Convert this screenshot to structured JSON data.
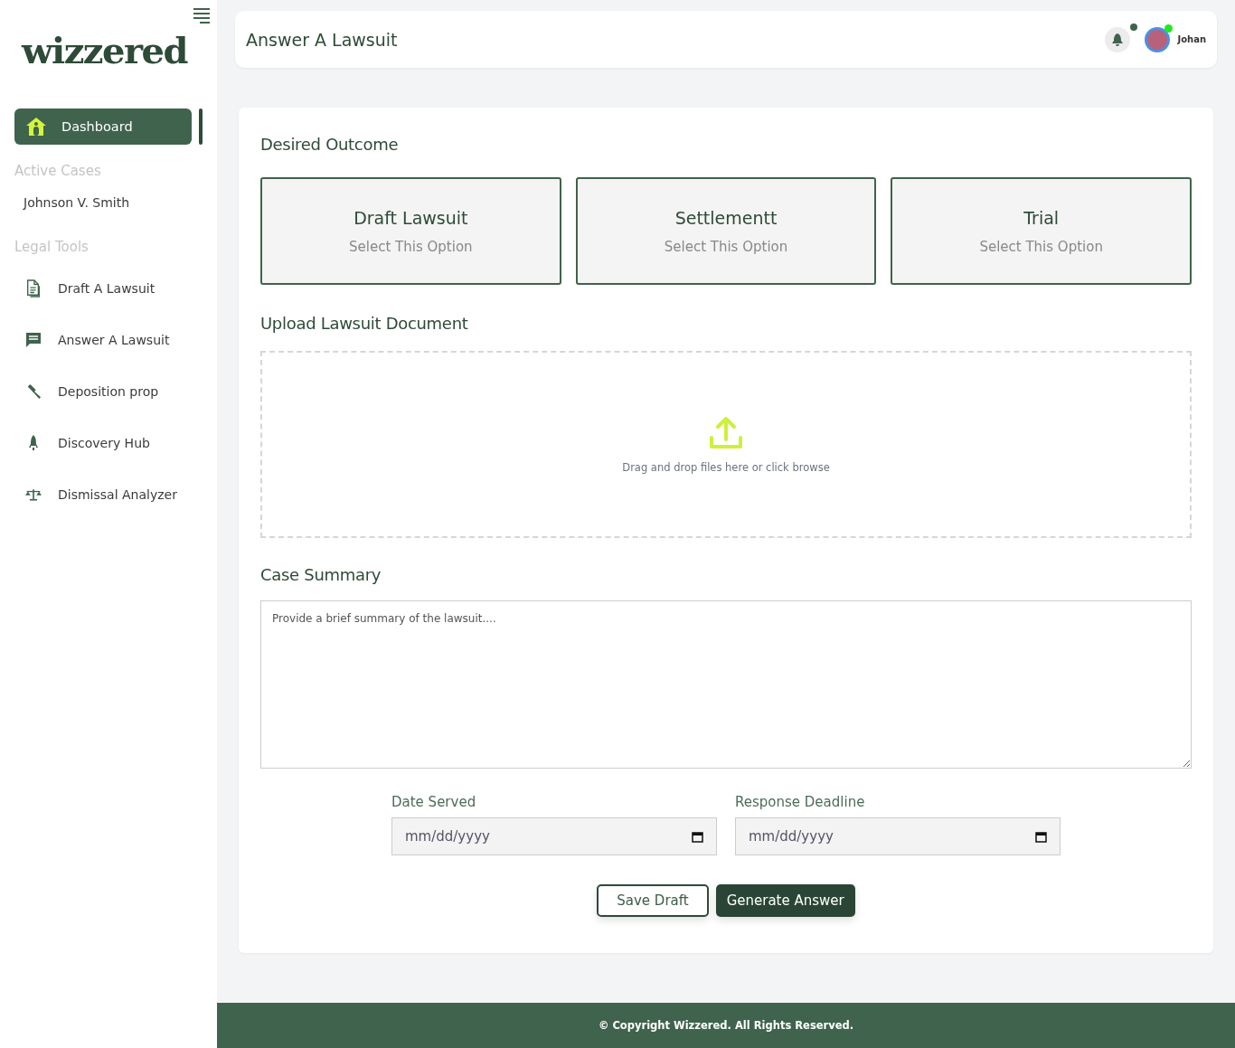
{
  "sidebar": {
    "logo": "wizzered",
    "nav": [
      {
        "label": "Dashboard",
        "selected": true
      }
    ],
    "sections": [
      {
        "title": "Active Cases",
        "items": [
          {
            "label": "Johnson V. Smith",
            "selected": false
          }
        ]
      },
      {
        "title": "Legal Tools",
        "items": [
          {
            "label": "Draft A Lawsuit",
            "selected": false
          },
          {
            "label": "Answer A Lawsuit",
            "selected": false
          },
          {
            "label": "Deposition prop",
            "selected": false
          },
          {
            "label": "Discovery Hub",
            "selected": false
          },
          {
            "label": "Dismissal Analyzer",
            "selected": false
          }
        ]
      }
    ]
  },
  "header": {
    "title": "Answer A Lawsuit",
    "user": "Johan",
    "notification_unread": true,
    "user_online": true
  },
  "outcome": {
    "title": "Desired Outcome",
    "options": [
      {
        "title": "Draft Lawsuit",
        "subtitle": "Select This Option",
        "selected": false
      },
      {
        "title": "Settlementt",
        "subtitle": "Select This Option",
        "selected": false
      },
      {
        "title": "Trial",
        "subtitle": "Select This Option",
        "selected": false
      }
    ]
  },
  "upload": {
    "title": "Upload Lawsuit Document",
    "hint": "Drag and drop files here or click browse"
  },
  "summary": {
    "title": "Case Summary",
    "placeholder": "Provide a brief summary of the lawsuit...."
  },
  "dates": [
    {
      "label": "Date Served",
      "placeholder": "mm/dd/yyyy"
    },
    {
      "label": "Response Deadline",
      "placeholder": "mm/dd/yyyy"
    }
  ],
  "buttons": [
    {
      "label": "Save Draft",
      "kind": "secondary"
    },
    {
      "label": "Generate Answer",
      "kind": "primary"
    }
  ],
  "footer": "© Copyright Wizzered. All Rights Reserved."
}
